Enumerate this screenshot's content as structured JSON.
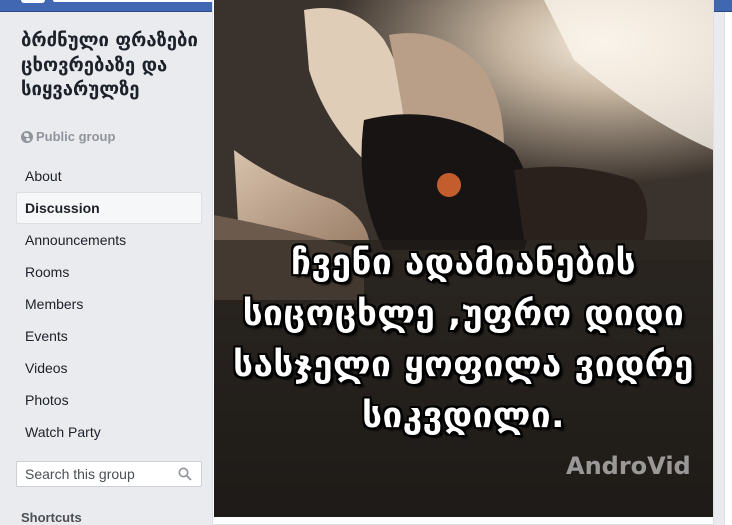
{
  "group": {
    "name": "ბრძნული ფრაზები ცხოვრებაზე და სიყვარულზე",
    "privacy": "Public group"
  },
  "nav": {
    "items": [
      {
        "label": "About"
      },
      {
        "label": "Discussion"
      },
      {
        "label": "Announcements"
      },
      {
        "label": "Rooms"
      },
      {
        "label": "Members"
      },
      {
        "label": "Events"
      },
      {
        "label": "Videos"
      },
      {
        "label": "Photos"
      },
      {
        "label": "Watch Party"
      }
    ],
    "active": "Discussion"
  },
  "group_search": {
    "placeholder": "Search this group"
  },
  "shortcuts": {
    "heading": "Shortcuts"
  },
  "post": {
    "image_caption": "ჩვენი ადამიანების სიცოცხლე ,უფრო დიდი სასჯელი ყოფილა ვიდრე სიკვდილი.",
    "watermark": "AndroVid"
  },
  "colors": {
    "topbar": "#4267b2",
    "page_background": "#e9ebee",
    "active_item_background": "#f6f7f9"
  }
}
